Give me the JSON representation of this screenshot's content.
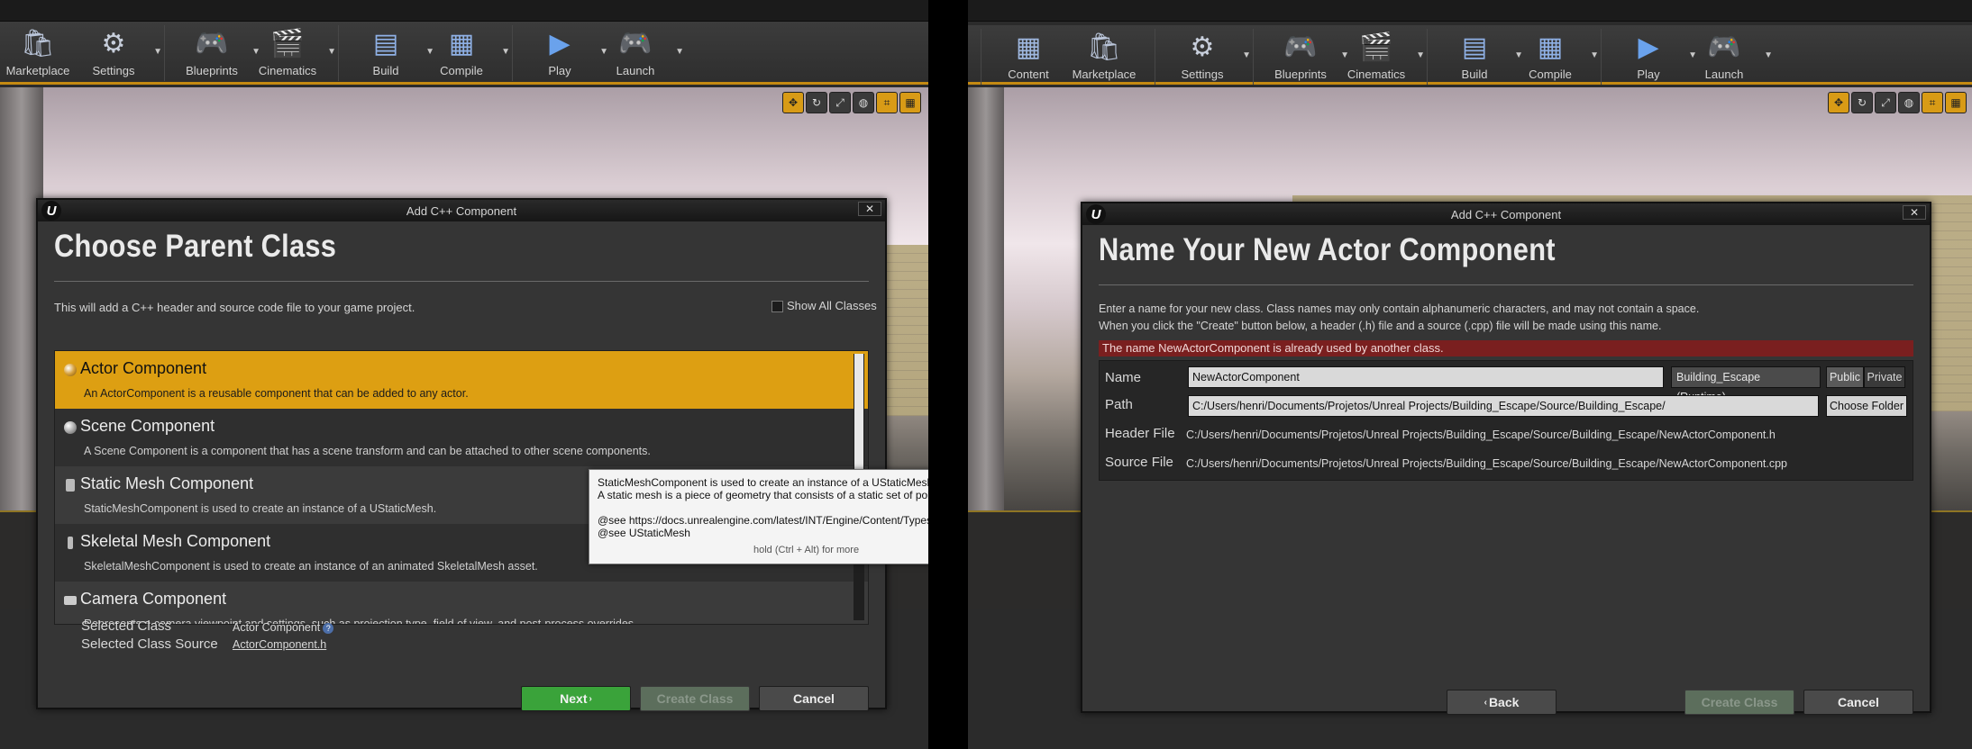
{
  "left": {
    "toolbar": {
      "items": [
        {
          "label": "Marketplace",
          "icon": "marketplace-icon",
          "dropdown": false
        },
        {
          "label": "Settings",
          "icon": "settings-icon",
          "dropdown": true
        },
        {
          "label": "Blueprints",
          "icon": "blueprints-icon",
          "dropdown": true
        },
        {
          "label": "Cinematics",
          "icon": "cinematics-icon",
          "dropdown": true
        },
        {
          "label": "Build",
          "icon": "build-icon",
          "dropdown": true
        },
        {
          "label": "Compile",
          "icon": "compile-icon",
          "dropdown": true
        },
        {
          "label": "Play",
          "icon": "play-icon",
          "dropdown": true
        },
        {
          "label": "Launch",
          "icon": "launch-icon",
          "dropdown": true
        }
      ]
    },
    "dialog": {
      "title": "Add C++ Component",
      "close": "✕",
      "heading": "Choose Parent Class",
      "description": "This will add a C++ header and source code file to your game project.",
      "show_all_classes": "Show All Classes",
      "classes": [
        {
          "name": "Actor Component",
          "desc": "An ActorComponent is a reusable component that can be added to any actor."
        },
        {
          "name": "Scene Component",
          "desc": "A Scene Component is a component that has a scene transform and can be attached to other scene components."
        },
        {
          "name": "Static Mesh Component",
          "desc": "StaticMeshComponent is used to create an instance of a UStaticMesh."
        },
        {
          "name": "Skeletal Mesh Component",
          "desc": "SkeletalMeshComponent is used to create an instance of an animated SkeletalMesh asset."
        },
        {
          "name": "Camera Component",
          "desc": "Represents a camera viewpoint and settings, such as projection type, field of view, and post-process overrides."
        }
      ],
      "selected_class_label": "Selected Class",
      "selected_class_value": "Actor Component",
      "selected_source_label": "Selected Class Source",
      "selected_source_value": "ActorComponent.h",
      "help": "?",
      "next": "Next",
      "create_class": "Create Class",
      "cancel": "Cancel"
    },
    "tooltip": {
      "line1": "StaticMeshComponent is used to create an instance of a UStaticMesh.",
      "line2": "A static mesh is a piece of geometry that consists of a static set of polygons.",
      "line3": "@see https://docs.unrealengine.com/latest/INT/Engine/Content/Types/StaticMeshes/",
      "line4": "@see UStaticMesh",
      "hint": "hold (Ctrl + Alt) for more"
    }
  },
  "right": {
    "toolbar": {
      "items": [
        {
          "label": "Content",
          "icon": "content-icon",
          "dropdown": false
        },
        {
          "label": "Marketplace",
          "icon": "marketplace-icon",
          "dropdown": false
        },
        {
          "label": "Settings",
          "icon": "settings-icon",
          "dropdown": true
        },
        {
          "label": "Blueprints",
          "icon": "blueprints-icon",
          "dropdown": true
        },
        {
          "label": "Cinematics",
          "icon": "cinematics-icon",
          "dropdown": true
        },
        {
          "label": "Build",
          "icon": "build-icon",
          "dropdown": true
        },
        {
          "label": "Compile",
          "icon": "compile-icon",
          "dropdown": true
        },
        {
          "label": "Play",
          "icon": "play-icon",
          "dropdown": true
        },
        {
          "label": "Launch",
          "icon": "launch-icon",
          "dropdown": true
        }
      ]
    },
    "dialog": {
      "title": "Add C++ Component",
      "close": "✕",
      "heading": "Name Your New Actor Component",
      "desc1": "Enter a name for your new class. Class names may only contain alphanumeric characters, and may not contain a space.",
      "desc2": "When you click the \"Create\" button below, a header (.h) file and a source (.cpp) file will be made using this name.",
      "error": "The name NewActorComponent is already used by another class.",
      "name_label": "Name",
      "name_value": "NewActorComponent",
      "module": "Building_Escape (Runtime)",
      "public": "Public",
      "private": "Private",
      "path_label": "Path",
      "path_value": "C:/Users/henri/Documents/Projetos/Unreal Projects/Building_Escape/Source/Building_Escape/",
      "choose_folder": "Choose Folder",
      "header_label": "Header File",
      "header_value": "C:/Users/henri/Documents/Projetos/Unreal Projects/Building_Escape/Source/Building_Escape/NewActorComponent.h",
      "source_label": "Source File",
      "source_value": "C:/Users/henri/Documents/Projetos/Unreal Projects/Building_Escape/Source/Building_Escape/NewActorComponent.cpp",
      "back": "Back",
      "create_class": "Create Class",
      "cancel": "Cancel"
    }
  },
  "colors": {
    "accent_orange": "#dd9f12",
    "next_green": "#3aa33a",
    "error_red": "#7a1f1f"
  }
}
